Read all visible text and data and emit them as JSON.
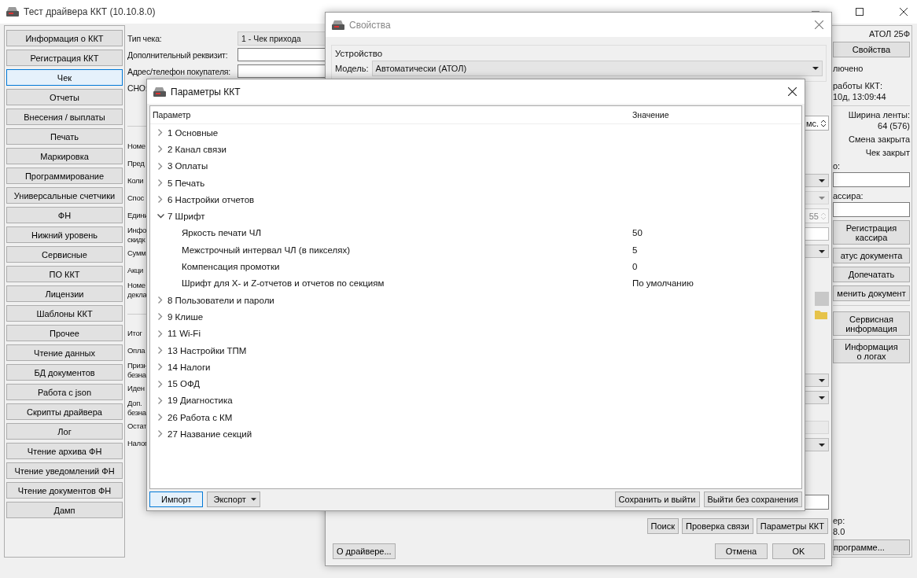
{
  "window": {
    "title": "Тест драйвера ККТ (10.10.8.0)"
  },
  "nav": [
    {
      "label": "Информация о ККТ",
      "selected": false
    },
    {
      "label": "Регистрация ККТ",
      "selected": false
    },
    {
      "label": "Чек",
      "selected": true
    },
    {
      "label": "Отчеты",
      "selected": false
    },
    {
      "label": "Внесения / выплаты",
      "selected": false
    },
    {
      "label": "Печать",
      "selected": false
    },
    {
      "label": "Маркировка",
      "selected": false
    },
    {
      "label": "Программирование",
      "selected": false
    },
    {
      "label": "Универсальные счетчики",
      "selected": false
    },
    {
      "label": "ФН",
      "selected": false
    },
    {
      "label": "Нижний уровень",
      "selected": false
    },
    {
      "label": "Сервисные",
      "selected": false
    },
    {
      "label": "ПО ККТ",
      "selected": false
    },
    {
      "label": "Лицензии",
      "selected": false
    },
    {
      "label": "Шаблоны ККТ",
      "selected": false
    },
    {
      "label": "Прочее",
      "selected": false
    },
    {
      "label": "Чтение данных",
      "selected": false
    },
    {
      "label": "БД документов",
      "selected": false
    },
    {
      "label": "Работа с json",
      "selected": false
    },
    {
      "label": "Скрипты драйвера",
      "selected": false
    },
    {
      "label": "Лог",
      "selected": false
    },
    {
      "label": "Чтение архива ФН",
      "selected": false
    },
    {
      "label": "Чтение уведомлений ФН",
      "selected": false
    },
    {
      "label": "Чтение документов ФН",
      "selected": false
    },
    {
      "label": "Дамп",
      "selected": false
    }
  ],
  "receipt_form": {
    "top_fields": [
      {
        "label": "Тип чека:",
        "kind": "combo",
        "value": "1 - Чек прихода"
      },
      {
        "label": "Дополнительный реквизит:",
        "kind": "input"
      },
      {
        "label": "Адрес/телефон покупателя:",
        "kind": "input"
      },
      {
        "label": "СНО:",
        "kind": "none"
      }
    ],
    "labels_1": [
      "Номе",
      "Пред",
      "Коли",
      "Спос",
      "Едини",
      "Инфо\nскидк",
      "Сумм",
      "Акци",
      "Номе\nдекла"
    ],
    "labels_2": [
      "Итог",
      "Опла",
      "Призн\nбезна",
      "Иден",
      "Доп.\nбезна",
      "Остат",
      "Налог"
    ]
  },
  "status_panel": {
    "model": "АТОЛ 25Ф",
    "properties_button": "Свойства",
    "connection": "лючено",
    "uptime_label": "работы ККТ:",
    "uptime": "10д, 13:09:44",
    "tape_width_label": "Ширина ленты:",
    "tape_width": "64 (576)",
    "shift": "Смена закрыта",
    "receipt": "Чек закрыт",
    "field_1_label": "о:",
    "field_2_label": "ассира:",
    "buttons_1": [
      "Регистрация\nкассира",
      "атус документа",
      "Допечатать",
      "менить документ"
    ],
    "buttons_2": [
      "Сервисная\nинформация",
      "Информация\nо логах"
    ],
    "version_label": "ер:",
    "version": "8.0",
    "about_button": "программе..."
  },
  "properties_dialog": {
    "title": "Свойства",
    "group": "Устройство",
    "model_label": "Модель:",
    "model_value": "Автоматически (АТОЛ)",
    "timeout_unit": "мс.",
    "spin_value": "55",
    "search_buttons": [
      "Поиск",
      "Проверка связи",
      "Параметры ККТ"
    ],
    "about_button": "О драйвере...",
    "buttons": [
      "Отмена",
      "OK"
    ]
  },
  "params_dialog": {
    "title": "Параметры ККТ",
    "columns": [
      "Параметр",
      "Значение"
    ],
    "tree": [
      {
        "label": "1 Основные",
        "expanded": false
      },
      {
        "label": "2 Канал связи",
        "expanded": false
      },
      {
        "label": "3 Оплаты",
        "expanded": false
      },
      {
        "label": "5 Печать",
        "expanded": false
      },
      {
        "label": "6 Настройки отчетов",
        "expanded": false
      },
      {
        "label": "7 Шрифт",
        "expanded": true,
        "children": [
          {
            "label": "Яркость печати ЧЛ",
            "value": "50"
          },
          {
            "label": "Межстрочный интервал ЧЛ (в пикселях)",
            "value": "5"
          },
          {
            "label": "Компенсация промотки",
            "value": "0"
          },
          {
            "label": "Шрифт для X- и Z-отчетов и отчетов по секциям",
            "value": "По умолчанию"
          }
        ]
      },
      {
        "label": "8 Пользователи и пароли",
        "expanded": false
      },
      {
        "label": "9 Клише",
        "expanded": false
      },
      {
        "label": "11 Wi-Fi",
        "expanded": false
      },
      {
        "label": "13 Настройки ТПМ",
        "expanded": false
      },
      {
        "label": "14 Налоги",
        "expanded": false
      },
      {
        "label": "15 ОФД",
        "expanded": false
      },
      {
        "label": "19 Диагностика",
        "expanded": false
      },
      {
        "label": "26 Работа с КМ",
        "expanded": false
      },
      {
        "label": "27 Название секций",
        "expanded": false
      }
    ],
    "import_button": "Импорт",
    "export_button": "Экспорт",
    "save_button": "Сохранить и выйти",
    "cancel_button": "Выйти без сохранения"
  }
}
